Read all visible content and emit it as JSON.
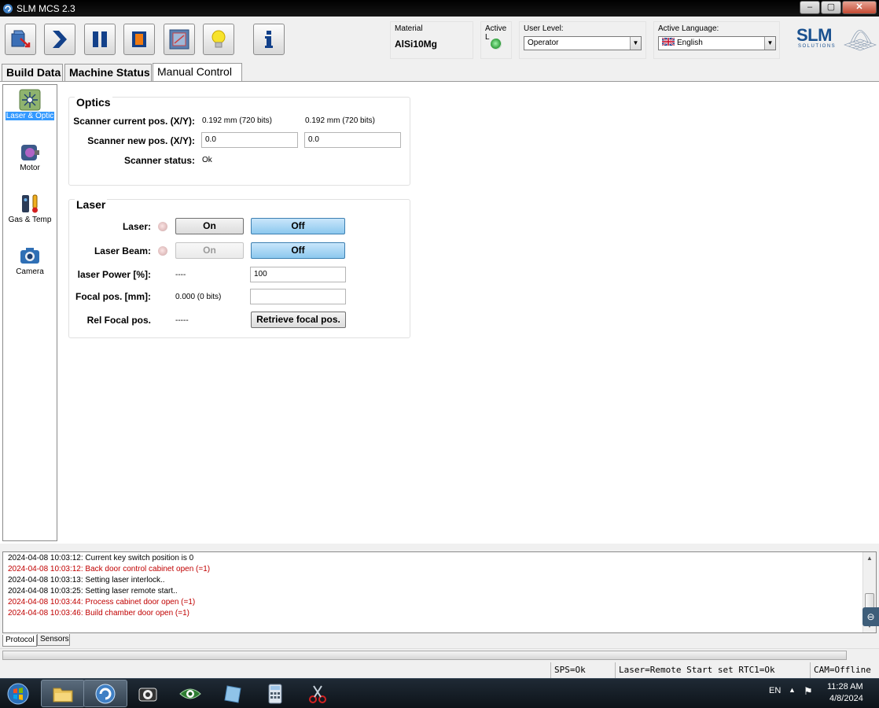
{
  "window": {
    "title": "SLM MCS 2.3"
  },
  "window_buttons": {
    "minimize": "–",
    "maximize": "▢",
    "close": "✕"
  },
  "toolbar": {
    "buttons": [
      {
        "icon": "open-build-icon"
      },
      {
        "icon": "start-icon"
      },
      {
        "icon": "pause-icon"
      },
      {
        "icon": "stop-icon"
      },
      {
        "icon": "layer-view-icon"
      },
      {
        "icon": "light-bulb-icon"
      },
      {
        "icon": "info-icon"
      }
    ]
  },
  "status_panels": {
    "material_label": "Material",
    "material_value": "AlSi10Mg",
    "active_label": "Active L",
    "user_level_label": "User Level:",
    "user_level_value": "Operator",
    "language_label": "Active Language:",
    "language_value": "English"
  },
  "logo": {
    "name": "SLM",
    "sub": "SOLUTIONS",
    "color": "#19508f"
  },
  "tabs": [
    {
      "label": "Build Data",
      "active": false
    },
    {
      "label": "Machine Status",
      "active": false
    },
    {
      "label": "Manual Control",
      "active": true
    }
  ],
  "leftnav": [
    {
      "label": "Laser & Optic",
      "icon": "laser-icon",
      "active": true
    },
    {
      "label": "Motor",
      "icon": "motor-icon",
      "active": false
    },
    {
      "label": "Gas & Temp",
      "icon": "gas-temp-icon",
      "active": false
    },
    {
      "label": "Camera",
      "icon": "camera-icon",
      "active": false
    }
  ],
  "optics": {
    "title": "Optics",
    "current_pos_label": "Scanner current pos. (X/Y):",
    "current_x": "0.192 mm (720 bits)",
    "current_y": "0.192 mm (720 bits)",
    "new_pos_label": "Scanner new pos. (X/Y):",
    "new_x": "0.0",
    "new_y": "0.0",
    "status_label": "Scanner status:",
    "status_value": "Ok"
  },
  "laser": {
    "title": "Laser",
    "laser_label": "Laser:",
    "laser_on": "On",
    "laser_off": "Off",
    "beam_label": "Laser Beam:",
    "beam_on": "On",
    "beam_off": "Off",
    "power_label": "laser Power [%]:",
    "power_current": "----",
    "power_value": "100",
    "focal_label": "Focal pos. [mm]:",
    "focal_current": "0.000 (0 bits)",
    "focal_value": "",
    "rel_focal_label": "Rel Focal pos.",
    "rel_focal_value": "-----",
    "retrieve_button": "Retrieve focal pos."
  },
  "log": [
    {
      "text": "2024-04-08 10:03:12: Current key switch position is 0",
      "level": "info"
    },
    {
      "text": "2024-04-08 10:03:12: Back door control cabinet open (=1)",
      "level": "error"
    },
    {
      "text": "2024-04-08 10:03:13: Setting laser interlock..",
      "level": "info"
    },
    {
      "text": "2024-04-08 10:03:25: Setting laser remote start..",
      "level": "info"
    },
    {
      "text": "2024-04-08 10:03:44: Process cabinet door open (=1)",
      "level": "error"
    },
    {
      "text": "2024-04-08 10:03:46: Build chamber door open (=1)",
      "level": "error"
    }
  ],
  "bottom_tabs": {
    "protocol": "Protocol",
    "sensors": "Sensors"
  },
  "statusbar": {
    "sps": "SPS=Ok",
    "laser": "Laser=Remote Start set RTC1=Ok",
    "cam": "CAM=Offline"
  },
  "taskbar": {
    "apps": [
      "start-orb-icon",
      "explorer-icon",
      "slm-mcs-icon",
      "camera-app-icon",
      "eye-app-icon",
      "notes-app-icon",
      "calculator-icon",
      "snipping-tool-icon"
    ],
    "language": "EN",
    "time": "11:28 AM",
    "date": "4/8/2024"
  },
  "colors": {
    "error_text": "#c00000",
    "selected_blue": "#3399ff",
    "accent_button": "#8cc8ee"
  }
}
